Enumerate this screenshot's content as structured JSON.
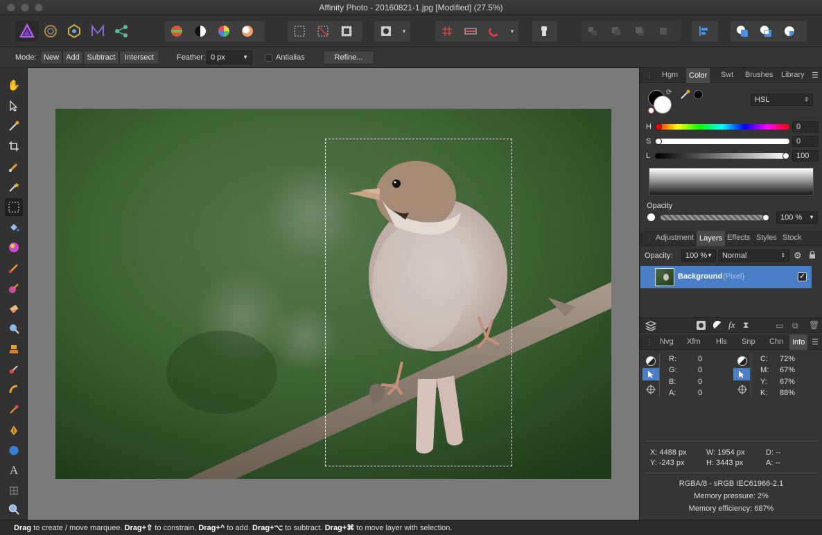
{
  "window": {
    "title": "Affinity Photo - 20160821-1.jpg [Modified] (27.5%)"
  },
  "context_toolbar": {
    "mode_label": "Mode:",
    "modes": [
      "New",
      "Add",
      "Subtract",
      "Intersect"
    ],
    "feather_label": "Feather:",
    "feather_value": "0 px",
    "antialias_label": "Antialias",
    "refine_label": "Refine..."
  },
  "color_panel": {
    "tabs": [
      "Hgm",
      "Color",
      "Swt",
      "Brushes",
      "Library"
    ],
    "active_tab": "Color",
    "model": "HSL",
    "sliders": [
      {
        "label": "H",
        "value": "0"
      },
      {
        "label": "S",
        "value": "0"
      },
      {
        "label": "L",
        "value": "100"
      }
    ],
    "opacity_label": "Opacity",
    "opacity_value": "100 %"
  },
  "layers_panel": {
    "tabs": [
      "Adjustment",
      "Layers",
      "Effects",
      "Styles",
      "Stock"
    ],
    "active_tab": "Layers",
    "opacity_label": "Opacity:",
    "opacity_value": "100 %",
    "blend_mode": "Normal",
    "layers": [
      {
        "name": "Background",
        "type": "(Pixel)",
        "visible": true
      }
    ]
  },
  "info_panel": {
    "tabs": [
      "Nvg",
      "Xfm",
      "His",
      "Snp",
      "Chn",
      "Info"
    ],
    "active_tab": "Info",
    "rgba": [
      {
        "label": "R:",
        "value": "0"
      },
      {
        "label": "G:",
        "value": "0"
      },
      {
        "label": "B:",
        "value": "0"
      },
      {
        "label": "A:",
        "value": "0"
      }
    ],
    "cmyk": [
      {
        "label": "C:",
        "value": "72%"
      },
      {
        "label": "M:",
        "value": "67%"
      },
      {
        "label": "Y:",
        "value": "67%"
      },
      {
        "label": "K:",
        "value": "88%"
      }
    ],
    "x": "X: 4488 px",
    "y": "Y: -243 px",
    "w": "W: 1954 px",
    "h": "H: 3443 px",
    "d": "D: --",
    "a": "A: --",
    "color_format": "RGBA/8 - sRGB IEC61966-2.1",
    "memory_pressure": "Memory pressure: 2%",
    "memory_efficiency": "Memory efficiency: 687%"
  },
  "status_bar": {
    "parts": [
      {
        "bold": "Drag",
        "text": " to create / move marquee. "
      },
      {
        "bold": "Drag+⇧",
        "text": " to constrain. "
      },
      {
        "bold": "Drag+^",
        "text": " to add. "
      },
      {
        "bold": "Drag+⌥",
        "text": " to subtract. "
      },
      {
        "bold": "Drag+⌘",
        "text": " to move layer with selection."
      }
    ]
  },
  "colors": {
    "accent": "#4a7fc7",
    "selection_row": "#4a7fc7",
    "panel_bg": "#353535",
    "canvas_bg": "#7a7a7a"
  }
}
